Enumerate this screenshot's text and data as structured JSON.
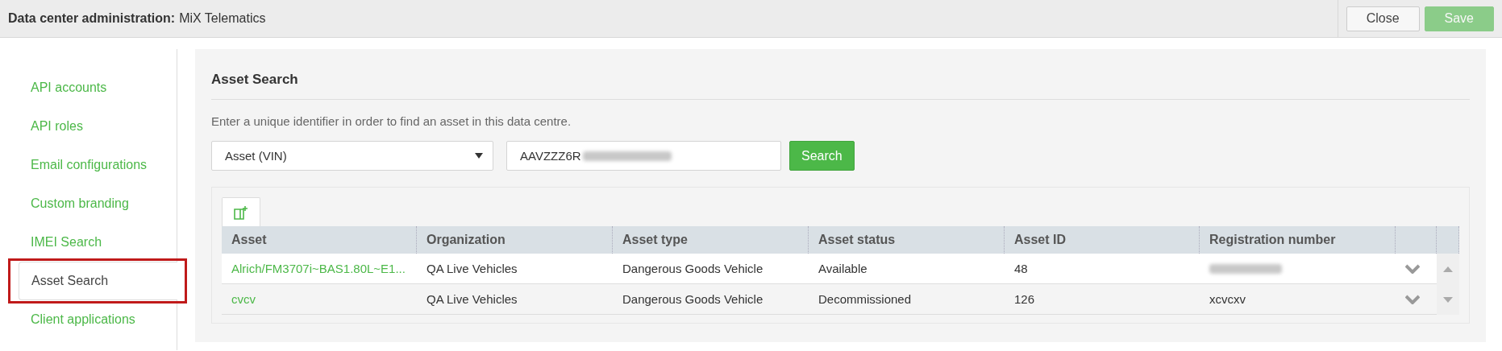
{
  "header": {
    "title_label": "Data center administration:",
    "title_value": "MiX Telematics",
    "buttons": [
      {
        "label": "Close",
        "kind": "secondary",
        "disabled": false
      },
      {
        "label": "Save",
        "kind": "primary",
        "disabled": true
      }
    ]
  },
  "sidebar": {
    "items": [
      {
        "label": "API accounts",
        "selected": false,
        "annotated": false
      },
      {
        "label": "API roles",
        "selected": false,
        "annotated": false
      },
      {
        "label": "Email configurations",
        "selected": false,
        "annotated": false
      },
      {
        "label": "Custom branding",
        "selected": false,
        "annotated": false
      },
      {
        "label": "IMEI Search",
        "selected": false,
        "annotated": false
      },
      {
        "label": "Asset Search",
        "selected": true,
        "annotated": true
      },
      {
        "label": "Client applications",
        "selected": false,
        "annotated": false
      }
    ]
  },
  "panel": {
    "title": "Asset Search",
    "description": "Enter a unique identifier in order to find an asset in this data centre.",
    "search_type": "Asset (VIN)",
    "search_value": "AAVZZZ6R",
    "search_value_redacted": true,
    "search_button": "Search"
  },
  "table": {
    "columns": [
      "Asset",
      "Organization",
      "Asset type",
      "Asset status",
      "Asset ID",
      "Registration number"
    ],
    "rows": [
      {
        "cells": [
          "Alrich/FM3707i~BAS1.80L~E1...",
          "QA Live Vehicles",
          "Dangerous Goods Vehicle",
          "Available",
          "48",
          ""
        ],
        "registration_redacted": true
      },
      {
        "cells": [
          "cvcv",
          "QA Live Vehicles",
          "Dangerous Goods Vehicle",
          "Decommissioned",
          "126",
          "xcvcxv"
        ],
        "registration_redacted": false
      }
    ]
  }
}
